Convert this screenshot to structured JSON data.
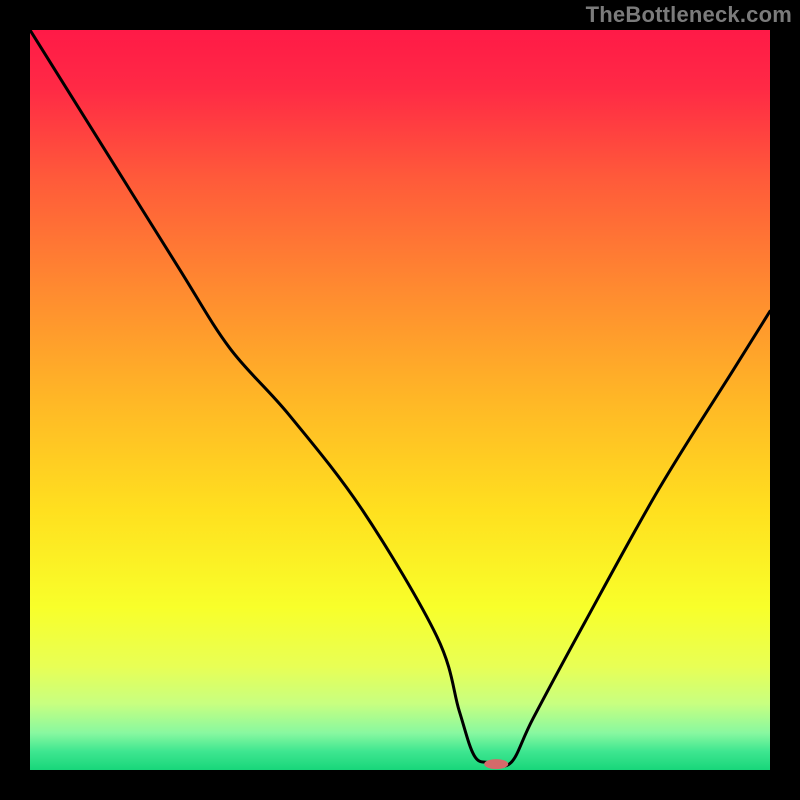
{
  "watermark": "TheBottleneck.com",
  "chart_data": {
    "type": "line",
    "title": "",
    "xlabel": "",
    "ylabel": "",
    "xlim": [
      0,
      100
    ],
    "ylim": [
      0,
      100
    ],
    "grid": false,
    "annotations": [],
    "series": [
      {
        "name": "bottleneck-curve",
        "x": [
          0,
          10,
          20,
          27,
          35,
          45,
          55,
          58,
          60,
          62,
          65,
          68,
          75,
          85,
          95,
          100
        ],
        "y": [
          100,
          84,
          68,
          57,
          48,
          35,
          18,
          8,
          2,
          1,
          1,
          7,
          20,
          38,
          54,
          62
        ]
      }
    ],
    "marker": {
      "x": 63,
      "y": 0.8,
      "color": "#d46a6a",
      "rx": 12,
      "ry": 5
    },
    "gradient_stops": [
      {
        "offset": 0.0,
        "color": "#ff1a47"
      },
      {
        "offset": 0.08,
        "color": "#ff2a45"
      },
      {
        "offset": 0.2,
        "color": "#ff5a3a"
      },
      {
        "offset": 0.35,
        "color": "#ff8a30"
      },
      {
        "offset": 0.5,
        "color": "#ffb726"
      },
      {
        "offset": 0.65,
        "color": "#ffe01f"
      },
      {
        "offset": 0.78,
        "color": "#f8ff2a"
      },
      {
        "offset": 0.86,
        "color": "#e8ff55"
      },
      {
        "offset": 0.91,
        "color": "#c8ff80"
      },
      {
        "offset": 0.95,
        "color": "#88f8a0"
      },
      {
        "offset": 0.975,
        "color": "#3ee690"
      },
      {
        "offset": 1.0,
        "color": "#18d67a"
      }
    ],
    "line_color": "#000000",
    "line_width": 3
  }
}
